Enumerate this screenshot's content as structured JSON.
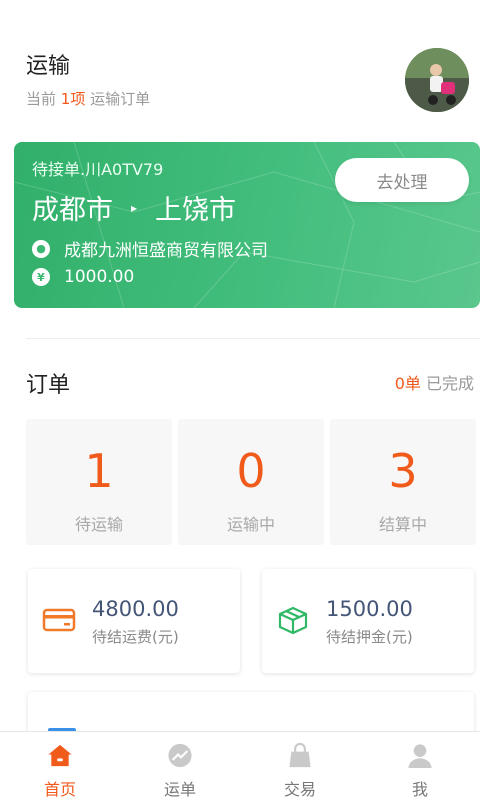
{
  "header": {
    "title": "运输",
    "sub_prefix": "当前",
    "sub_count": "1项",
    "sub_suffix": "运输订单"
  },
  "current_order": {
    "code": "待接单.川A0TV79",
    "from": "成都市",
    "arrow": "▸",
    "to": "上饶市",
    "process_label": "去处理",
    "company": "成都九洲恒盛商贸有限公司",
    "amount": "1000.00",
    "yen_symbol": "¥"
  },
  "orders": {
    "title": "订单",
    "done_count": "0单",
    "done_label": "已完成",
    "stats": [
      {
        "value": "1",
        "label": "待运输"
      },
      {
        "value": "0",
        "label": "运输中"
      },
      {
        "value": "3",
        "label": "结算中"
      }
    ]
  },
  "money": [
    {
      "amount": "4800.00",
      "label": "待结运费(元)",
      "icon": "card-icon"
    },
    {
      "amount": "1500.00",
      "label": "待结押金(元)",
      "icon": "box-icon"
    }
  ],
  "tabs": [
    {
      "label": "首页",
      "icon": "home-icon",
      "active": true
    },
    {
      "label": "运单",
      "icon": "waybill-icon",
      "active": false
    },
    {
      "label": "交易",
      "icon": "bag-icon",
      "active": false
    },
    {
      "label": "我",
      "icon": "user-icon",
      "active": false
    }
  ],
  "colors": {
    "accent": "#f05a1a",
    "green": "#3db774",
    "muted": "#9a9a9a"
  }
}
